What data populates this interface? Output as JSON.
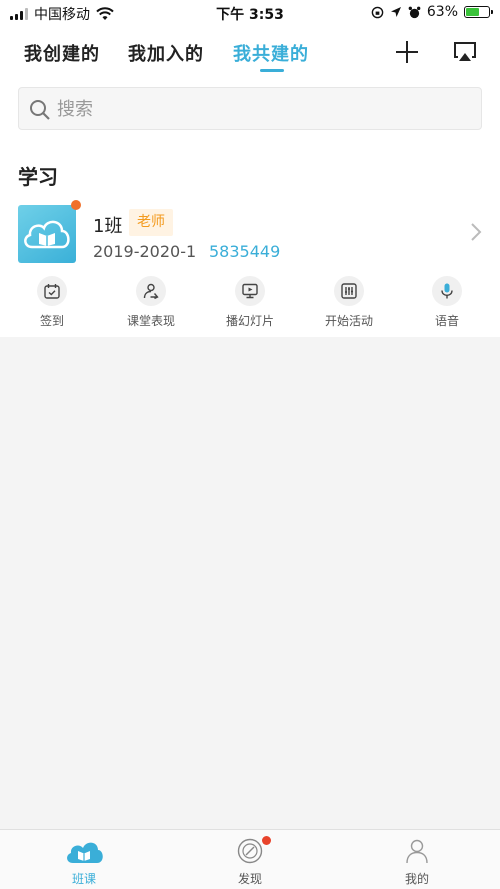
{
  "status_bar": {
    "carrier": "中国移动",
    "time": "下午 3:53",
    "battery_percent": "63%",
    "battery_level": 0.63
  },
  "header": {
    "tabs": [
      {
        "label": "我创建的"
      },
      {
        "label": "我加入的"
      },
      {
        "label": "我共建的"
      }
    ],
    "active_tab": 2
  },
  "search": {
    "placeholder": "搜索",
    "value": ""
  },
  "section": {
    "title": "学习"
  },
  "class_item": {
    "name": "1班",
    "role": "老师",
    "term": "2019-2020-1",
    "code": "5835449"
  },
  "actions": [
    {
      "label": "签到",
      "icon": "calendar-check-icon"
    },
    {
      "label": "课堂表现",
      "icon": "person-performance-icon"
    },
    {
      "label": "播幻灯片",
      "icon": "slideshow-icon"
    },
    {
      "label": "开始活动",
      "icon": "sliders-icon"
    },
    {
      "label": "语音",
      "icon": "microphone-icon"
    }
  ],
  "bottom_nav": [
    {
      "label": "班课",
      "icon": "cloud-book-icon",
      "active": true
    },
    {
      "label": "发现",
      "icon": "compass-icon",
      "active": false,
      "badge": true
    },
    {
      "label": "我的",
      "icon": "person-icon",
      "active": false
    }
  ],
  "colors": {
    "accent": "#3aaed8",
    "role_badge_text": "#f39a1d",
    "notification_dot": "#e8432b"
  }
}
